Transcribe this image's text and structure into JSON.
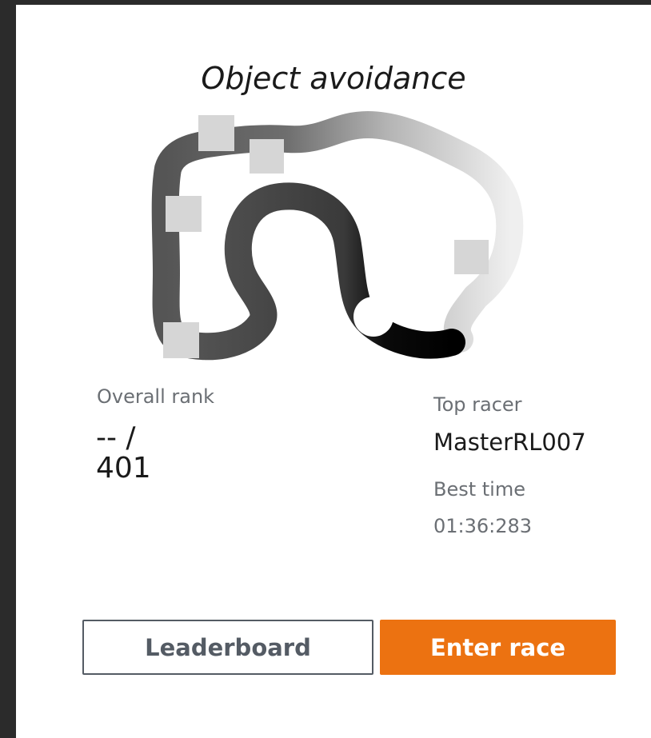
{
  "card": {
    "title": "Object avoidance",
    "overall_rank_label": "Overall rank",
    "overall_rank_value_line1": "-- /",
    "overall_rank_value_line2": "401",
    "top_racer_label": "Top racer",
    "top_racer_value": "MasterRL007",
    "best_time_label": "Best time",
    "best_time_value": "01:36:283"
  },
  "buttons": {
    "leaderboard_label": "Leaderboard",
    "enter_race_label": "Enter race"
  },
  "colors": {
    "primary": "#ec7211",
    "secondary_border": "#545b64"
  }
}
